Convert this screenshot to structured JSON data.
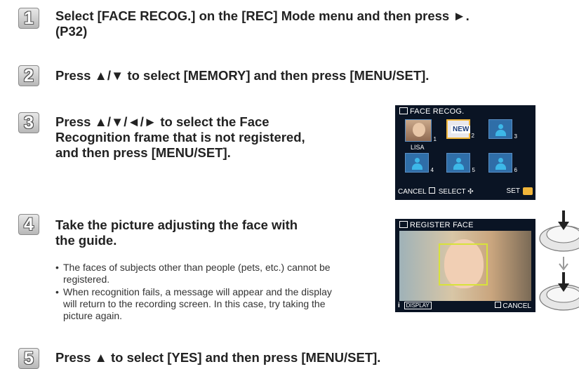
{
  "steps": [
    {
      "number": "1",
      "lines": [
        "Select [FACE RECOG.] on the [REC] Mode menu and then press ►.",
        "(P32)"
      ]
    },
    {
      "number": "2",
      "lines": [
        "Press ▲/▼ to select [MEMORY] and then press [MENU/SET]."
      ]
    },
    {
      "number": "3",
      "lines": [
        "Press ▲/▼/◄/► to select the Face",
        "Recognition frame that is not registered,",
        "and then press [MENU/SET]."
      ]
    },
    {
      "number": "4",
      "lines": [
        "Take the picture adjusting the face with",
        "the guide."
      ]
    },
    {
      "number": "5",
      "lines": [
        "Press ▲ to select [YES] and then press [MENU/SET]."
      ]
    }
  ],
  "step4_bullets": [
    "The faces of subjects other than people (pets, etc.) cannot be registered.",
    "When recognition fails, a message will appear and the display will return to the recording screen. In this case, try taking the picture again."
  ],
  "screen1": {
    "title": "FACE RECOG.",
    "frames": [
      {
        "label": "1",
        "kind": "photo",
        "name": "LISA"
      },
      {
        "label": "2",
        "kind": "new",
        "name": "NEW"
      },
      {
        "label": "3",
        "kind": "empty"
      },
      {
        "label": "4",
        "kind": "empty"
      },
      {
        "label": "5",
        "kind": "empty"
      },
      {
        "label": "6",
        "kind": "empty"
      }
    ],
    "footer_cancel": "CANCEL",
    "footer_select": "SELECT",
    "footer_set": "SET"
  },
  "screen2": {
    "title": "REGISTER FACE",
    "footer_left": "DISPLAY",
    "footer_cancel": "CANCEL"
  },
  "colors": {
    "badge": "#b8b8b8",
    "lcd_bg": "#0a1424",
    "frame_blue": "#2f6ea8",
    "accent_yellow": "#f0b53a"
  }
}
